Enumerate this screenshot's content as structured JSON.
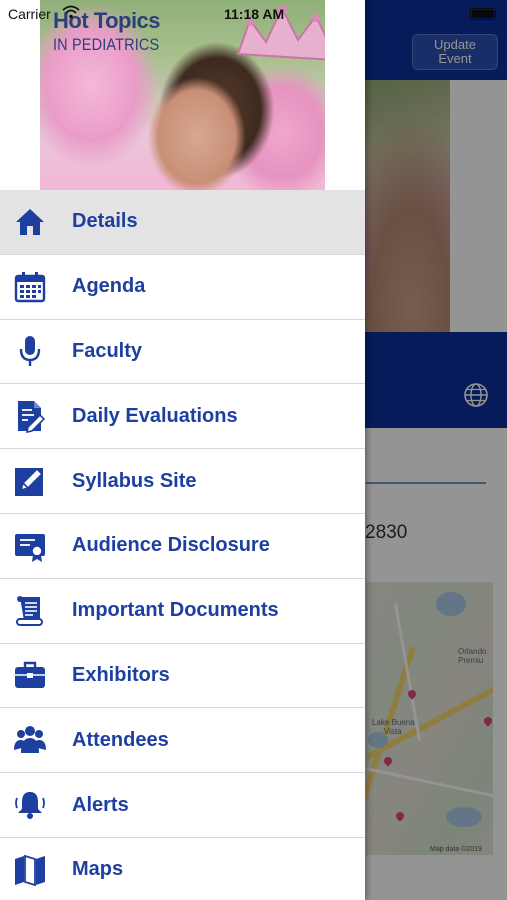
{
  "status_bar": {
    "carrier": "Carrier",
    "time": "11:18 AM"
  },
  "header": {
    "title_line1": "Hot Topics",
    "title_line2": "IN PEDIATRICS"
  },
  "background": {
    "update_button": "Update\nEvent",
    "number_fragment": "2830",
    "map_credit": "Map data ©2019"
  },
  "menu": [
    {
      "label": "Details",
      "icon": "home-icon",
      "selected": true
    },
    {
      "label": "Agenda",
      "icon": "calendar-icon"
    },
    {
      "label": "Faculty",
      "icon": "microphone-icon"
    },
    {
      "label": "Daily Evaluations",
      "icon": "evaluation-document-icon"
    },
    {
      "label": "Syllabus Site",
      "icon": "edit-pencil-icon"
    },
    {
      "label": "Audience Disclosure",
      "icon": "certificate-icon"
    },
    {
      "label": "Important Documents",
      "icon": "scroll-document-icon"
    },
    {
      "label": "Exhibitors",
      "icon": "briefcase-icon"
    },
    {
      "label": "Attendees",
      "icon": "people-group-icon"
    },
    {
      "label": "Alerts",
      "icon": "bell-icon"
    },
    {
      "label": "Maps",
      "icon": "map-icon"
    }
  ],
  "colors": {
    "accent": "#1d3fa0",
    "navbar": "#0d2f9c",
    "selected_row": "#e3e3e3"
  }
}
